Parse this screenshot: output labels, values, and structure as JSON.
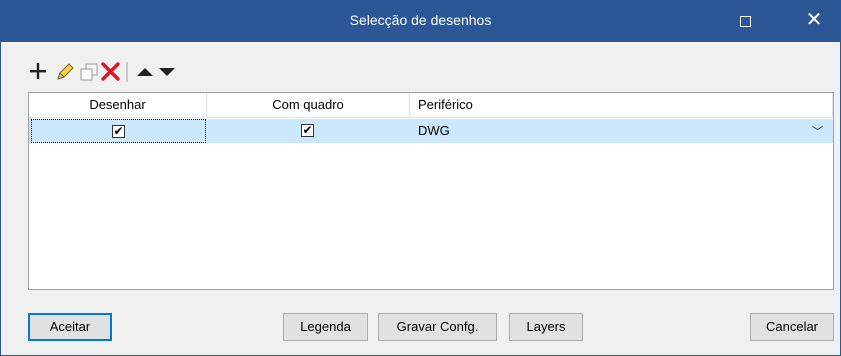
{
  "window": {
    "title": "Selecção de desenhos",
    "maximize_icon": "maximize-icon",
    "close_icon": "close-icon",
    "close_glyph": "✕"
  },
  "toolbar": {
    "items": [
      "add-icon",
      "edit-pencil-icon",
      "copy-icon",
      "delete-icon",
      "move-up-icon",
      "move-down-icon"
    ],
    "colors": {
      "delete": "#e81123",
      "pencil": "#f0c020",
      "arrows": "#222222"
    }
  },
  "grid": {
    "columns": [
      "Desenhar",
      "Com quadro",
      "Periférico"
    ],
    "rows": [
      {
        "desenhar": true,
        "com_quadro": true,
        "periferico": "DWG"
      }
    ],
    "selected_row_color": "#cce8ff",
    "dropdown_glyph": "﹀"
  },
  "checkmark": "✔",
  "buttons": {
    "accept": "Aceitar",
    "legend": "Legenda",
    "save_config": "Gravar Confg.",
    "layers": "Layers",
    "cancel": "Cancelar"
  },
  "colors": {
    "titlebar": "#2b5797",
    "default_button_border": "#0078d7"
  }
}
